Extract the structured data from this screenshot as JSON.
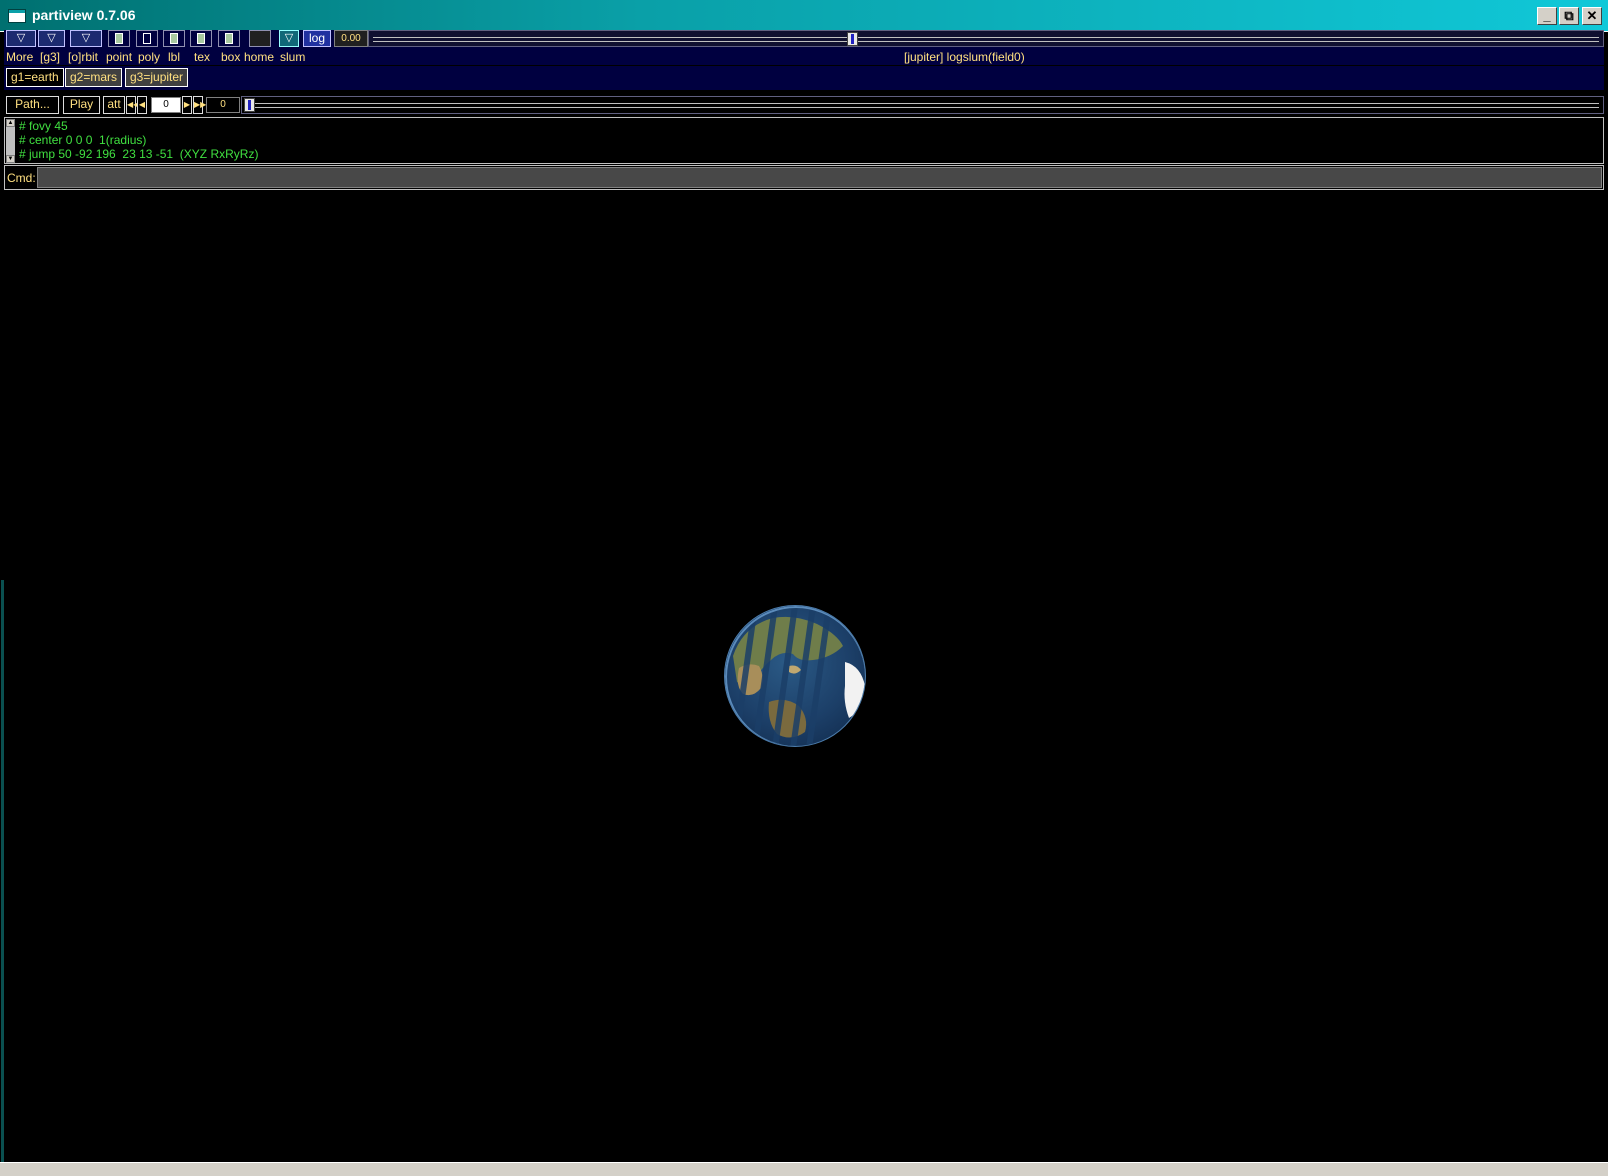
{
  "window": {
    "title": "partiview 0.7.06",
    "controls": {
      "minimize": "_",
      "restore": "⧉",
      "close": "✕"
    }
  },
  "toolbar": {
    "labels": {
      "more": "More",
      "group": "[g3]",
      "orbit": "[o]rbit",
      "point": "point",
      "poly": "poly",
      "lbl": "lbl",
      "tex": "tex",
      "box": "box",
      "home": "home",
      "slum": "slum"
    },
    "toggles": {
      "point": true,
      "poly": false,
      "lbl": true,
      "tex": true,
      "box": true
    },
    "log_label": "log",
    "slum_value": "0.00",
    "slider_fraction": 0.39,
    "status": "[jupiter] logslum(field0)"
  },
  "groups": [
    {
      "label": "g1=earth",
      "active": true
    },
    {
      "label": "g2=mars",
      "active": false
    },
    {
      "label": "g3=jupiter",
      "active": false
    }
  ],
  "path": {
    "path_label": "Path...",
    "play_label": "Play",
    "att_label": "att",
    "frame_input": "0",
    "frame_value": "0",
    "slider_fraction": 0.0
  },
  "console": {
    "lines": [
      "# fovy 45",
      "# center 0 0 0  1(radius)",
      "# jump 50 -92 196  23 13 -51  (XYZ RxRyRz)"
    ]
  },
  "cmd": {
    "label": "Cmd:",
    "value": ""
  },
  "colors": {
    "title_gradient_start": "#007070",
    "title_gradient_end": "#10c8d8",
    "panel_bg": "#000040",
    "label_yellow": "#ffe080",
    "console_green": "#40e040"
  }
}
